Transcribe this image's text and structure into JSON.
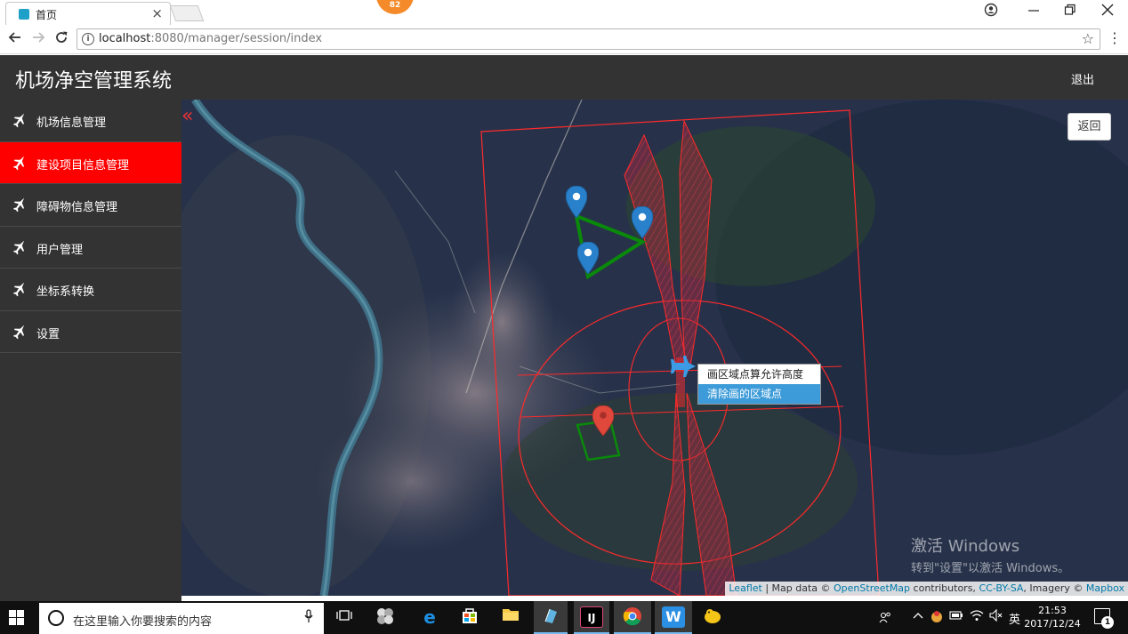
{
  "browser": {
    "tab_title": "首页",
    "tab_close": "×",
    "badge_count": "82",
    "url_host": "localhost",
    "url_rest": ":8080/manager/session/index"
  },
  "app": {
    "title": "机场净空管理系统",
    "logout_label": "退出"
  },
  "sidebar": {
    "items": [
      {
        "label": "机场信息管理",
        "active": false
      },
      {
        "label": "建设项目信息管理",
        "active": true
      },
      {
        "label": "障碍物信息管理",
        "active": false
      },
      {
        "label": "用户管理",
        "active": false
      },
      {
        "label": "坐标系转换",
        "active": false
      },
      {
        "label": "设置",
        "active": false
      }
    ],
    "active_color": "#ff0000"
  },
  "map": {
    "back_label": "返回",
    "collapse_icon": "«",
    "context_menu": [
      "画区域点算允许高度",
      "清除画的区域点"
    ],
    "watermark_line1": "激活 Windows",
    "watermark_line2": "转到\"设置\"以激活 Windows。",
    "attribution": {
      "leaflet": "Leaflet",
      "sep1": " | Map data © ",
      "osm": "OpenStreetMap",
      "contributors": " contributors, ",
      "license": "CC-BY-SA",
      "imagery": ", Imagery © ",
      "mapbox": "Mapbox"
    },
    "marker_colors": {
      "blue": "#2a81cb",
      "red": "#e0483c"
    },
    "surface_color": "#ff2a2a",
    "polygon_color": "#0a8a0a"
  },
  "taskbar": {
    "search_placeholder": "在这里输入你要搜索的内容",
    "ime_label": "英",
    "time": "21:53",
    "date": "2017/12/24",
    "notifications": "1"
  }
}
